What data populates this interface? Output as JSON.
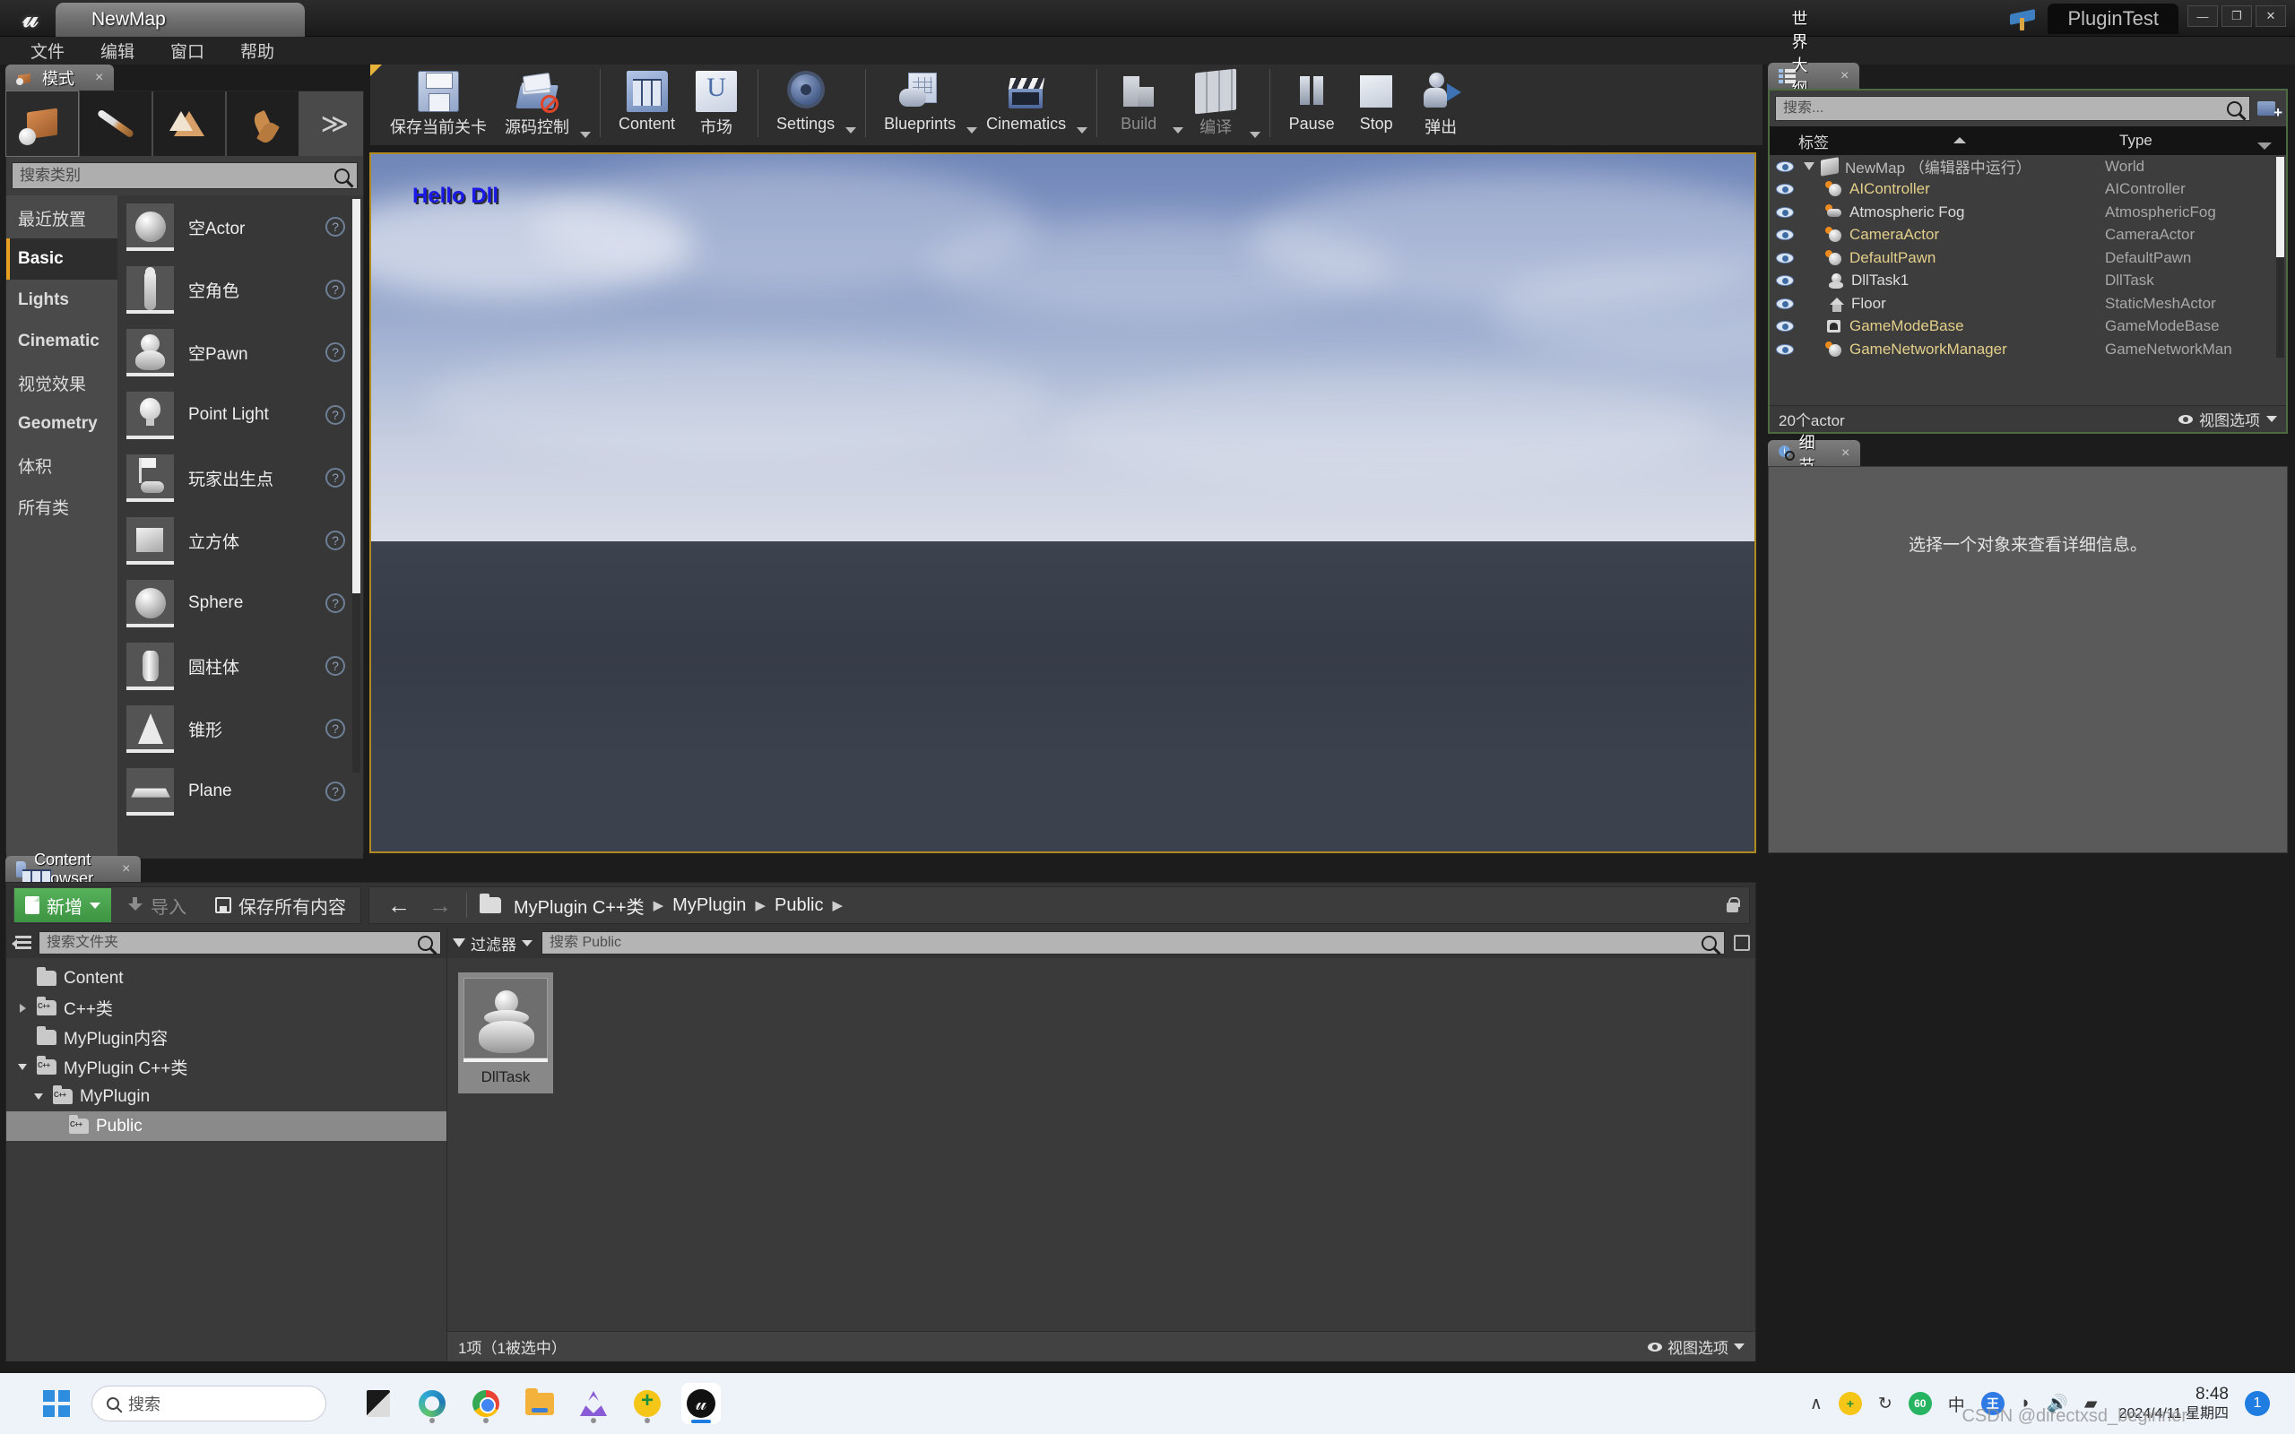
{
  "titlebar": {
    "map_tab": "NewMap",
    "project_name": "PluginTest",
    "logo": "unreal-logo",
    "minimize": "—",
    "maximize": "❐",
    "close": "✕"
  },
  "menubar": {
    "items": [
      "文件",
      "编辑",
      "窗口",
      "帮助"
    ]
  },
  "toolbar": {
    "groups": [
      {
        "buttons": [
          {
            "label": "保存当前关卡",
            "icon": "save-icon",
            "caret": false,
            "dim": false
          },
          {
            "label": "源码控制",
            "icon": "source-control-icon",
            "caret": true,
            "dim": false
          }
        ]
      },
      {
        "buttons": [
          {
            "label": "Content",
            "icon": "content-browser-icon",
            "caret": false,
            "dim": false
          },
          {
            "label": "市场",
            "icon": "marketplace-icon",
            "caret": false,
            "dim": false
          }
        ]
      },
      {
        "buttons": [
          {
            "label": "Settings",
            "icon": "settings-gear-icon",
            "caret": true,
            "dim": false
          }
        ]
      },
      {
        "buttons": [
          {
            "label": "Blueprints",
            "icon": "blueprints-icon",
            "caret": true,
            "dim": false
          },
          {
            "label": "Cinematics",
            "icon": "cinematics-icon",
            "caret": true,
            "dim": false
          }
        ]
      },
      {
        "buttons": [
          {
            "label": "Build",
            "icon": "build-icon",
            "caret": true,
            "dim": true
          },
          {
            "label": "编译",
            "icon": "compile-icon",
            "caret": true,
            "dim": true
          }
        ]
      },
      {
        "buttons": [
          {
            "label": "Pause",
            "icon": "pause-icon",
            "caret": false,
            "dim": false
          },
          {
            "label": "Stop",
            "icon": "stop-icon",
            "caret": false,
            "dim": false
          },
          {
            "label": "弹出",
            "icon": "eject-icon",
            "caret": false,
            "dim": false
          }
        ]
      }
    ]
  },
  "modes_panel": {
    "tab_title": "模式",
    "tab_icon": "modes-icon",
    "close": "×",
    "mode_icons": [
      {
        "name": "place-mode-icon",
        "selected": true
      },
      {
        "name": "paint-mode-icon",
        "selected": false
      },
      {
        "name": "landscape-mode-icon",
        "selected": false
      },
      {
        "name": "foliage-mode-icon",
        "selected": false
      }
    ],
    "more_glyph": "≫",
    "search_placeholder": "搜索类别",
    "search_value": "",
    "categories": [
      {
        "label": "最近放置",
        "selected": false,
        "bold": false
      },
      {
        "label": "Basic",
        "selected": true,
        "bold": true
      },
      {
        "label": "Lights",
        "selected": false,
        "bold": true
      },
      {
        "label": "Cinematic",
        "selected": false,
        "bold": true
      },
      {
        "label": "视觉效果",
        "selected": false,
        "bold": false
      },
      {
        "label": "Geometry",
        "selected": false,
        "bold": true
      },
      {
        "label": "体积",
        "selected": false,
        "bold": false
      },
      {
        "label": "所有类",
        "selected": false,
        "bold": false
      }
    ],
    "assets": [
      {
        "label": "空Actor",
        "thumb": "sphere-thumb",
        "help": "?"
      },
      {
        "label": "空角色",
        "thumb": "character-thumb",
        "help": "?"
      },
      {
        "label": "空Pawn",
        "thumb": "pawn-thumb",
        "help": "?"
      },
      {
        "label": "Point Light",
        "thumb": "bulb-thumb",
        "help": "?"
      },
      {
        "label": "玩家出生点",
        "thumb": "playerstart-thumb",
        "help": "?"
      },
      {
        "label": "立方体",
        "thumb": "cube-thumb",
        "help": "?"
      },
      {
        "label": "Sphere",
        "thumb": "sphere-thumb",
        "help": "?"
      },
      {
        "label": "圆柱体",
        "thumb": "cylinder-thumb",
        "help": "?"
      },
      {
        "label": "锥形",
        "thumb": "cone-thumb",
        "help": "?"
      },
      {
        "label": "Plane",
        "thumb": "plane-thumb",
        "help": "?"
      }
    ]
  },
  "viewport": {
    "overlay_text": "Hello Dll",
    "overlay_color": "#1a19e8",
    "border_color": "#b08a20"
  },
  "outliner": {
    "tab_title": "世界大纲视图",
    "tab_icon": "outliner-icon",
    "close": "×",
    "search_placeholder": "搜索...",
    "search_value": "",
    "add_button": "add-actor-icon",
    "columns": [
      "标签",
      "Type"
    ],
    "rows": [
      {
        "label": "NewMap （编辑器中运行）",
        "type": "World",
        "icon": "world-icon",
        "indent": 0,
        "highlight": false,
        "expander": "open"
      },
      {
        "label": "AIController",
        "type": "AIController",
        "icon": "actor-icon",
        "indent": 1,
        "highlight": true,
        "expander": ""
      },
      {
        "label": "Atmospheric Fog",
        "type": "AtmosphericFog",
        "icon": "fog-icon",
        "indent": 1,
        "highlight": false,
        "expander": ""
      },
      {
        "label": "CameraActor",
        "type": "CameraActor",
        "icon": "camera-icon",
        "indent": 1,
        "highlight": true,
        "expander": ""
      },
      {
        "label": "DefaultPawn",
        "type": "DefaultPawn",
        "icon": "pawn-icon",
        "indent": 1,
        "highlight": true,
        "expander": ""
      },
      {
        "label": "DllTask1",
        "type": "DllTask",
        "icon": "dlltask-icon",
        "indent": 1,
        "highlight": false,
        "expander": ""
      },
      {
        "label": "Floor",
        "type": "StaticMeshActor",
        "icon": "mesh-icon",
        "indent": 1,
        "highlight": false,
        "expander": ""
      },
      {
        "label": "GameModeBase",
        "type": "GameModeBase",
        "icon": "gamemode-icon",
        "indent": 1,
        "highlight": true,
        "expander": ""
      },
      {
        "label": "GameNetworkManager",
        "type": "GameNetworkMan",
        "icon": "netmanager-icon",
        "indent": 1,
        "highlight": true,
        "expander": ""
      }
    ],
    "footer_count": "20个actor",
    "footer_viewopts": "视图选项"
  },
  "details": {
    "tab_title": "细节",
    "tab_icon": "details-icon",
    "close": "×",
    "empty_message": "选择一个对象来查看详细信息。"
  },
  "content_browser": {
    "tab_title": "Content Browser",
    "tab_icon": "content-browser-icon",
    "close": "×",
    "add_button": "新增",
    "import_button": "导入",
    "save_all_button": "保存所有内容",
    "nav_back": "←",
    "nav_forward": "→",
    "breadcrumbs": [
      "MyPlugin C++类",
      "MyPlugin",
      "Public"
    ],
    "folder_search_placeholder": "搜索文件夹",
    "folder_search_value": "",
    "tree": [
      {
        "label": "Content",
        "indent": 0,
        "expander": "",
        "icon": "folder-icon",
        "selected": false
      },
      {
        "label": "C++类",
        "indent": 0,
        "expander": "closed",
        "icon": "cpp-folder-icon",
        "selected": false
      },
      {
        "label": "MyPlugin内容",
        "indent": 0,
        "expander": "",
        "icon": "folder-icon",
        "selected": false
      },
      {
        "label": "MyPlugin C++类",
        "indent": 0,
        "expander": "open",
        "icon": "cpp-folder-icon",
        "selected": false
      },
      {
        "label": "MyPlugin",
        "indent": 1,
        "expander": "open",
        "icon": "cpp-folder-icon",
        "selected": false
      },
      {
        "label": "Public",
        "indent": 2,
        "expander": "",
        "icon": "cpp-folder-icon",
        "selected": true
      }
    ],
    "filter_button": "过滤器",
    "asset_search_placeholder": "搜索 Public",
    "asset_search_value": "",
    "assets": [
      {
        "name": "DllTask",
        "thumb": "pawn-thumb",
        "selected": true
      }
    ],
    "status_count": "1项（1被选中）",
    "status_viewopts": "视图选项"
  },
  "taskbar": {
    "start": "windows-logo-icon",
    "search_text": "搜索",
    "apps": [
      {
        "name": "task-view-icon",
        "running": false,
        "active": false
      },
      {
        "name": "edge-icon",
        "running": true,
        "active": false
      },
      {
        "name": "chrome-icon",
        "running": true,
        "active": false
      },
      {
        "name": "file-explorer-icon",
        "running": false,
        "active": false
      },
      {
        "name": "visual-studio-icon",
        "running": true,
        "active": false
      },
      {
        "name": "360-security-icon",
        "running": true,
        "active": false
      },
      {
        "name": "unreal-editor-icon",
        "running": true,
        "active": true
      }
    ],
    "tray": [
      {
        "name": "show-hidden-icons-chevron",
        "glyph": "∧"
      },
      {
        "name": "360-tray-icon",
        "glyph": "+"
      },
      {
        "name": "sync-tray-icon",
        "glyph": "↻"
      },
      {
        "name": "speed-tray-icon",
        "glyph": "60"
      },
      {
        "name": "ime-chinese-icon",
        "glyph": "中"
      },
      {
        "name": "wangwang-icon",
        "glyph": "王"
      },
      {
        "name": "wifi-icon",
        "glyph": "◗"
      },
      {
        "name": "volume-icon",
        "glyph": "🔊"
      },
      {
        "name": "battery-icon",
        "glyph": "▰"
      }
    ],
    "clock_time": "8:48",
    "clock_date": "2024/4/11 星期四",
    "notification_count": "1"
  },
  "watermark": "CSDN @directxsd_beginner"
}
